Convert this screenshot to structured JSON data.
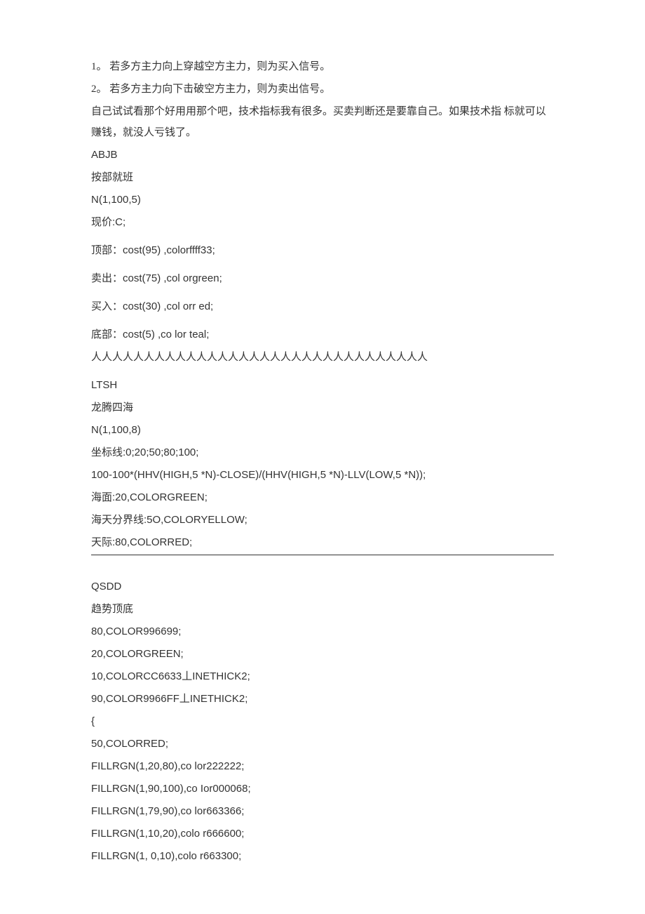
{
  "lines": [
    {
      "text": "1。 若多方主力向上穿越空方主力，则为买入信号。",
      "class": "line"
    },
    {
      "text": "2。 若多方主力向下击破空方主力，则为卖出信号。",
      "class": "line"
    },
    {
      "text": " 自己试试看那个好用用那个吧，技术指标我有很多。买卖判断还是要靠自己。如果技术指 标就可以赚钱，就没人亏钱了。",
      "class": "line"
    },
    {
      "text": "ABJB",
      "class": "line latin"
    },
    {
      "text": "按部就班",
      "class": "line"
    },
    {
      "text": "N(1,100,5)",
      "class": "line latin"
    },
    {
      "text": "现价:C;",
      "class": "line latin"
    },
    {
      "text": "顶部：cost(95) ,colorffff33;",
      "class": "line latin section-gap"
    },
    {
      "text": "卖出：cost(75) ,col orgreen;",
      "class": "line latin section-gap"
    },
    {
      "text": "买入：cost(30) ,col orr ed;",
      "class": "line latin section-gap"
    },
    {
      "text": "底部：cost(5) ,co lor teal;",
      "class": "line latin section-gap"
    },
    {
      "text": "人人人人人人人人人人人人人人人人人人人人人人人人人人人人人人人人",
      "class": "line"
    },
    {
      "text": "LTSH",
      "class": "line latin section-gap"
    },
    {
      "text": "龙腾四海",
      "class": "line"
    },
    {
      "text": "N(1,100,8)",
      "class": "line latin"
    },
    {
      "text": "坐标线:0;20;50;80;100;",
      "class": "line latin"
    },
    {
      "text": "100-100*(HHV(HIGH,5 *N)-CLOSE)/(HHV(HIGH,5 *N)-LLV(LOW,5 *N));",
      "class": "line latin"
    },
    {
      "text": "海面:20,COLORGREEN;",
      "class": "line latin"
    },
    {
      "text": "海天分界线:5O,COLORYELLOW;",
      "class": "line latin"
    },
    {
      "text": "天际:80,COLORRED;",
      "class": "line latin underline"
    },
    {
      "text": "QSDD",
      "class": "line latin",
      "style": "margin-top:28px;"
    },
    {
      "text": "趋势顶底",
      "class": "line"
    },
    {
      "text": "80,COLOR996699;",
      "class": "line latin"
    },
    {
      "text": "20,COLORGREEN;",
      "class": "line latin"
    },
    {
      "text": "10,COLORCC6633丄INETHICK2;",
      "class": "line latin"
    },
    {
      "text": "90,COLOR9966FF丄INETHICK2;",
      "class": "line latin"
    },
    {
      "text": "{",
      "class": "line latin"
    },
    {
      "text": "50,COLORRED;",
      "class": "line latin"
    },
    {
      "text": "FILLRGN(1,20,80),co lor222222;",
      "class": "line latin"
    },
    {
      "text": "FILLRGN(1,90,100),co Ior000068;",
      "class": "line latin"
    },
    {
      "text": "FILLRGN(1,79,90),co lor663366;",
      "class": "line latin"
    },
    {
      "text": "FILLRGN(1,10,20),colo r666600;",
      "class": "line latin"
    },
    {
      "text": "FILLRGN(1, 0,10),colo r663300;",
      "class": "line latin"
    }
  ]
}
